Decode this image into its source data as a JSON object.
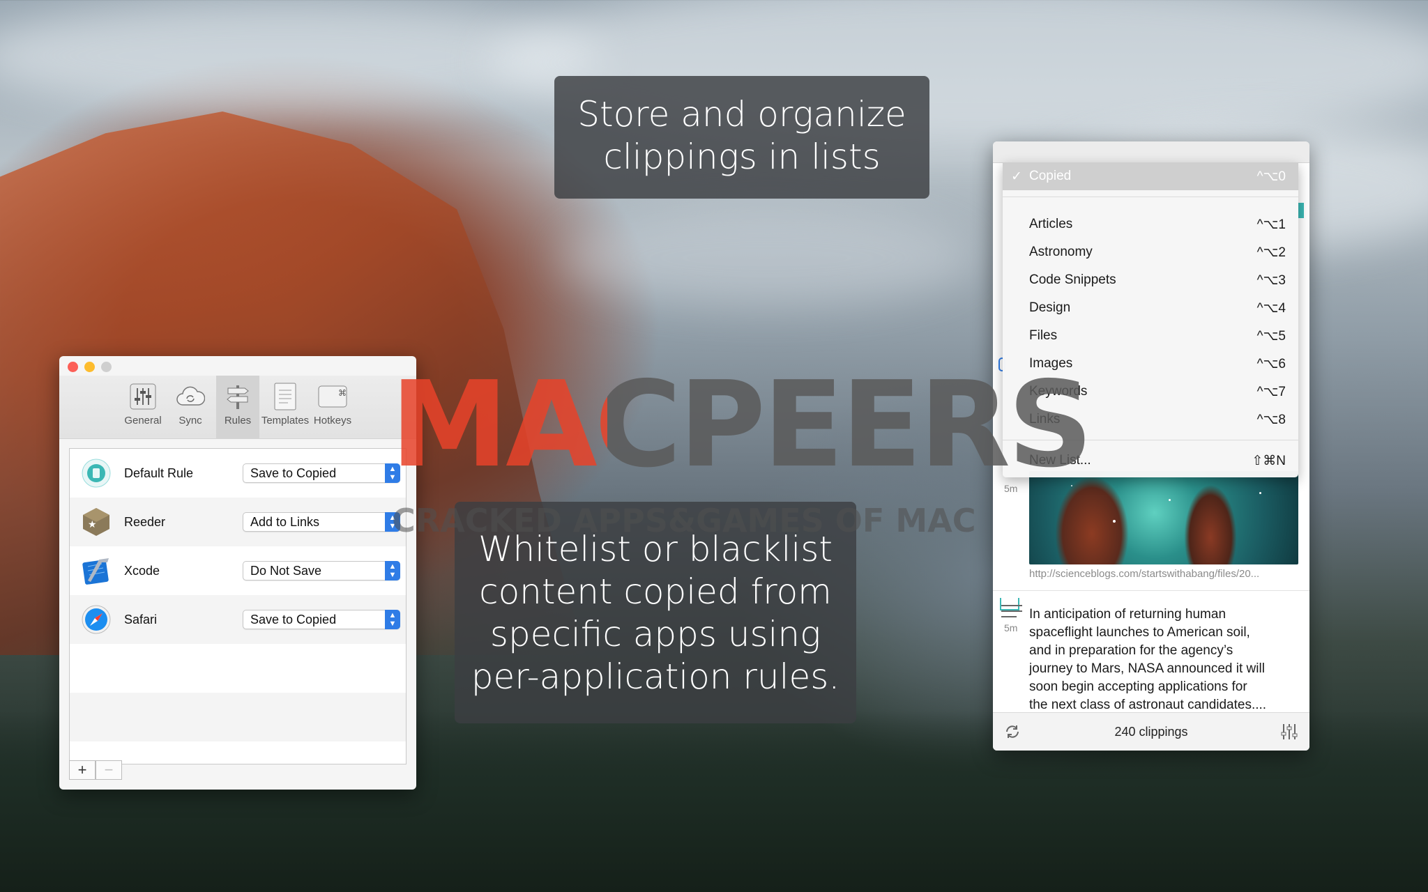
{
  "banners": {
    "top": {
      "line1": "Store and organize",
      "line2": "clippings in lists"
    },
    "middle": {
      "line1": "Whitelist or blacklist",
      "line2": "content copied from",
      "line3": "specific apps using",
      "line4": "per-application rules."
    }
  },
  "watermark": {
    "brand": "MACPEERS",
    "tagline": "CRACKED APPS&GAMES OF MAC"
  },
  "preferences": {
    "tabs": [
      {
        "label": "General",
        "icon": "sliders-icon"
      },
      {
        "label": "Sync",
        "icon": "cloud-sync-icon"
      },
      {
        "label": "Rules",
        "icon": "signpost-icon",
        "active": true
      },
      {
        "label": "Templates",
        "icon": "document-icon"
      },
      {
        "label": "Hotkeys",
        "icon": "command-key-icon"
      }
    ],
    "rules": [
      {
        "app": "Default Rule",
        "icon": "default-rule-icon",
        "action": "Save to Copied"
      },
      {
        "app": "Reeder",
        "icon": "reeder-icon",
        "action": "Add to Links"
      },
      {
        "app": "Xcode",
        "icon": "xcode-icon",
        "action": "Do Not Save"
      },
      {
        "app": "Safari",
        "icon": "safari-icon",
        "action": "Save to Copied"
      }
    ],
    "add_label": "+",
    "remove_label": "−"
  },
  "copied": {
    "menu": {
      "selected": {
        "label": "Copied",
        "shortcut": "^⌥0"
      },
      "items": [
        {
          "label": "Articles",
          "shortcut": "^⌥1"
        },
        {
          "label": "Astronomy",
          "shortcut": "^⌥2"
        },
        {
          "label": "Code Snippets",
          "shortcut": "^⌥3"
        },
        {
          "label": "Design",
          "shortcut": "^⌥4"
        },
        {
          "label": "Files",
          "shortcut": "^⌥5"
        },
        {
          "label": "Images",
          "shortcut": "^⌥6"
        },
        {
          "label": "Keywords",
          "shortcut": "^⌥7"
        },
        {
          "label": "Links",
          "shortcut": "^⌥8"
        }
      ],
      "new_list": {
        "label": "New List...",
        "shortcut": "⇧⌘N"
      }
    },
    "clip_image": {
      "age": "5m",
      "url": "http://scienceblogs.com/startswithabang/files/20..."
    },
    "clip_text": {
      "age": "5m",
      "lines": [
        "In anticipation of returning human",
        "spaceflight launches to American soil,",
        "and in preparation for the agency’s",
        "journey to Mars, NASA announced it will",
        "soon begin accepting applications for",
        "the next class of astronaut candidates...."
      ]
    },
    "footer": {
      "count": "240 clippings"
    }
  },
  "colors": {
    "accent": "#2f7ce6",
    "close": "#fc5f57",
    "minimize": "#fdbc2e",
    "zoom": "#28c840",
    "watermark_red": "#e8432a",
    "watermark_gray": "#5a5a5a"
  }
}
